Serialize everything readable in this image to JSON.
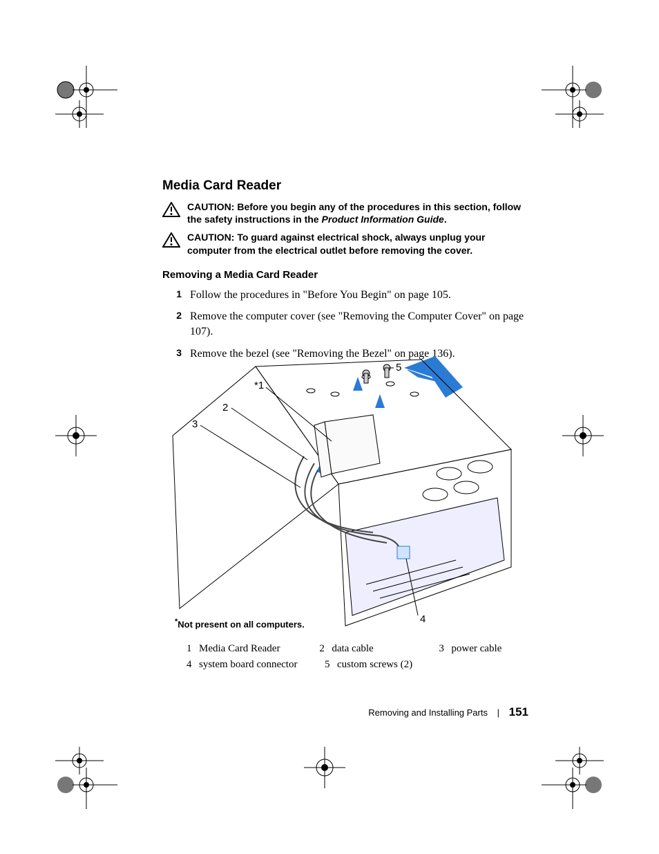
{
  "section_title": "Media Card Reader",
  "cautions": [
    {
      "lead": "CAUTION:",
      "text_before_italic": " Before you begin any of the procedures in this section, follow the safety instructions in the ",
      "italic": "Product Information Guide",
      "text_after_italic": "."
    },
    {
      "lead": "CAUTION:",
      "text_before_italic": " To guard against electrical shock, always unplug your computer from the electrical outlet before removing the cover.",
      "italic": "",
      "text_after_italic": ""
    }
  ],
  "subheading": "Removing a Media Card Reader",
  "steps": [
    {
      "num": "1",
      "text": "Follow the procedures in \"Before You Begin\" on page 105."
    },
    {
      "num": "2",
      "text": "Remove the computer cover (see \"Removing the Computer Cover\" on page 107)."
    },
    {
      "num": "3",
      "text": "Remove the bezel (see \"Removing the Bezel\" on page 136)."
    }
  ],
  "diagram": {
    "callouts": {
      "1": "*1",
      "2": "2",
      "3": "3",
      "4": "4",
      "5": "5"
    }
  },
  "footnote": "Not present on all computers.",
  "legend": [
    {
      "num": "1",
      "label": "Media Card Reader"
    },
    {
      "num": "2",
      "label": "data cable"
    },
    {
      "num": "3",
      "label": "power cable"
    },
    {
      "num": "4",
      "label": "system board connector"
    },
    {
      "num": "5",
      "label": "custom screws (2)"
    }
  ],
  "footer": {
    "chapter": "Removing and Installing Parts",
    "page": "151"
  }
}
